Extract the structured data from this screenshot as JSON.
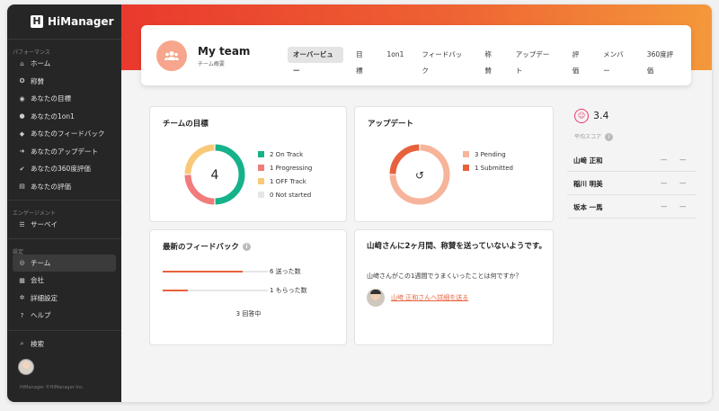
{
  "app": {
    "name": "HiManager",
    "copyright": "HiManager ©HiManager Inc."
  },
  "sidebar": {
    "sections": [
      {
        "label": "パフォーマンス",
        "items": [
          {
            "label": "ホーム",
            "icon": "home-icon"
          },
          {
            "label": "称賛",
            "icon": "medal-icon"
          },
          {
            "label": "あなたの目標",
            "icon": "target-icon"
          },
          {
            "label": "あなたの1on1",
            "icon": "person-icon"
          },
          {
            "label": "あなたのフィードバック",
            "icon": "chat-icon"
          },
          {
            "label": "あなたのアップデート",
            "icon": "arrow-icon"
          },
          {
            "label": "あなたの360度評価",
            "icon": "check-circle-icon"
          },
          {
            "label": "あなたの評価",
            "icon": "document-icon"
          }
        ]
      },
      {
        "label": "エンゲージメント",
        "items": [
          {
            "label": "サーベイ",
            "icon": "list-icon"
          }
        ]
      },
      {
        "label": "設定",
        "items": [
          {
            "label": "チーム",
            "icon": "team-icon",
            "active": true
          },
          {
            "label": "会社",
            "icon": "building-icon"
          },
          {
            "label": "詳細設定",
            "icon": "gear-icon"
          },
          {
            "label": "ヘルプ",
            "icon": "help-icon"
          }
        ]
      }
    ],
    "search_label": "検索"
  },
  "header": {
    "title": "My team",
    "subtitle": "チーム概要",
    "tabs": [
      "オーバービュー",
      "目標",
      "1on1",
      "フィードバック",
      "称賛",
      "アップデート",
      "評価",
      "メンバー",
      "360度評価"
    ],
    "active_tab": 0
  },
  "goals": {
    "title": "チームの目標",
    "center": "4",
    "legend": [
      {
        "label": "2 On Track",
        "value": 2,
        "color": "#16b28a"
      },
      {
        "label": "1 Progressing",
        "value": 1,
        "color": "#f27b7b"
      },
      {
        "label": "1 OFF Track",
        "value": 1,
        "color": "#f9c97a"
      },
      {
        "label": "0 Not started",
        "value": 0,
        "color": "#e6e6e6"
      }
    ]
  },
  "updates": {
    "title": "アップデート",
    "legend": [
      {
        "label": "3 Pending",
        "value": 3,
        "color": "#f6b49a"
      },
      {
        "label": "1 Submitted",
        "value": 1,
        "color": "#e8613d"
      }
    ]
  },
  "feedback": {
    "title": "最新のフィードバック",
    "rows": [
      {
        "label": "6 送った数",
        "fraction": 0.76
      },
      {
        "label": "1 もらった数",
        "fraction": 0.24
      }
    ],
    "total": "3 回答中"
  },
  "prompt": {
    "title": "山﨑さんに2ヶ月間、称賛を送っていないようです。",
    "question": "山﨑さんがこの1週間でうまくいったことは何ですか？",
    "link": "山﨑 正和さんへ詳細を送る"
  },
  "score": {
    "value": "3.4",
    "label": "平均スコア",
    "members": [
      {
        "name": "山﨑 正和",
        "d1": "—",
        "d2": "—"
      },
      {
        "name": "稲川 明美",
        "d1": "—",
        "d2": "—"
      },
      {
        "name": "坂本 一馬",
        "d1": "—",
        "d2": "—"
      }
    ]
  }
}
